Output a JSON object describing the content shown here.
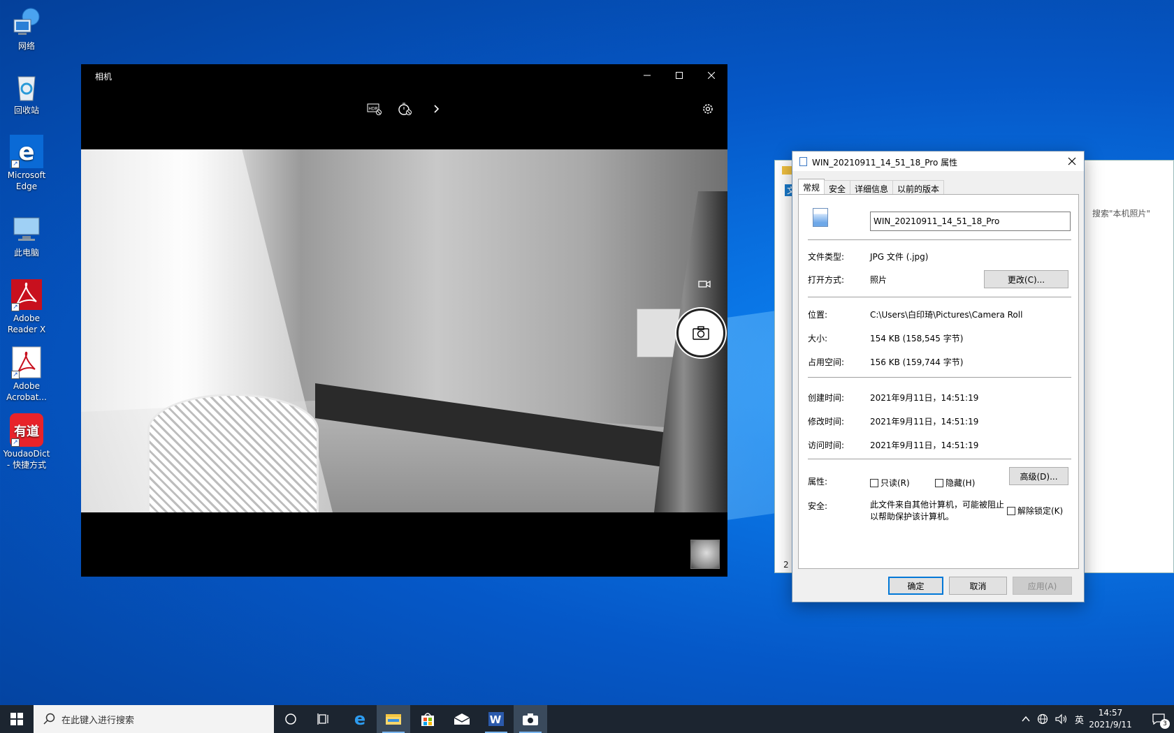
{
  "desktop": {
    "icons": [
      {
        "label": "网络",
        "icon": "network-icon"
      },
      {
        "label": "回收站",
        "icon": "recycle-bin-icon"
      },
      {
        "label": "Microsoft Edge",
        "icon": "edge-icon"
      },
      {
        "label": "此电脑",
        "icon": "this-pc-icon"
      },
      {
        "label": "Adobe Reader X",
        "icon": "adobe-reader-icon"
      },
      {
        "label": "Adobe Acrobat...",
        "icon": "adobe-acrobat-icon"
      },
      {
        "label": "YoudaoDict - 快捷方式",
        "icon": "youdao-icon"
      }
    ]
  },
  "camera": {
    "title": "相机",
    "toolbar": [
      "hdr-icon",
      "timer-icon",
      "chevron-right-icon"
    ],
    "settings_icon": "gear-icon"
  },
  "explorer": {
    "search_placeholder": "搜索\"本机照片\"",
    "status_count": "2",
    "tab_partial": "文"
  },
  "properties": {
    "title": "WIN_20210911_14_51_18_Pro 属性",
    "tabs": [
      "常规",
      "安全",
      "详细信息",
      "以前的版本"
    ],
    "active_tab": "常规",
    "file_name": "WIN_20210911_14_51_18_Pro",
    "file_type_label": "文件类型:",
    "file_type_value": "JPG 文件 (.jpg)",
    "open_with_label": "打开方式:",
    "open_with_value": "照片",
    "change_button": "更改(C)...",
    "location_label": "位置:",
    "location_value": "C:\\Users\\白印琦\\Pictures\\Camera Roll",
    "size_label": "大小:",
    "size_value": "154 KB (158,545 字节)",
    "size_on_disk_label": "占用空间:",
    "size_on_disk_value": "156 KB (159,744 字节)",
    "created_label": "创建时间:",
    "created_value": "2021年9月11日，14:51:19",
    "modified_label": "修改时间:",
    "modified_value": "2021年9月11日，14:51:19",
    "accessed_label": "访问时间:",
    "accessed_value": "2021年9月11日，14:51:19",
    "attributes_label": "属性:",
    "readonly_label": "只读(R)",
    "hidden_label": "隐藏(H)",
    "advanced_button": "高级(D)...",
    "security_label": "安全:",
    "security_text_1": "此文件来自其他计算机，可能被阻止",
    "security_text_2": "以帮助保护该计算机。",
    "unblock_label": "解除锁定(K)",
    "ok_button": "确定",
    "cancel_button": "取消",
    "apply_button": "应用(A)"
  },
  "taskbar": {
    "search_placeholder": "在此键入进行搜索",
    "ime": "英",
    "time": "14:57",
    "date": "2021/9/11",
    "notification_count": "3",
    "accent": "#0078d7"
  }
}
